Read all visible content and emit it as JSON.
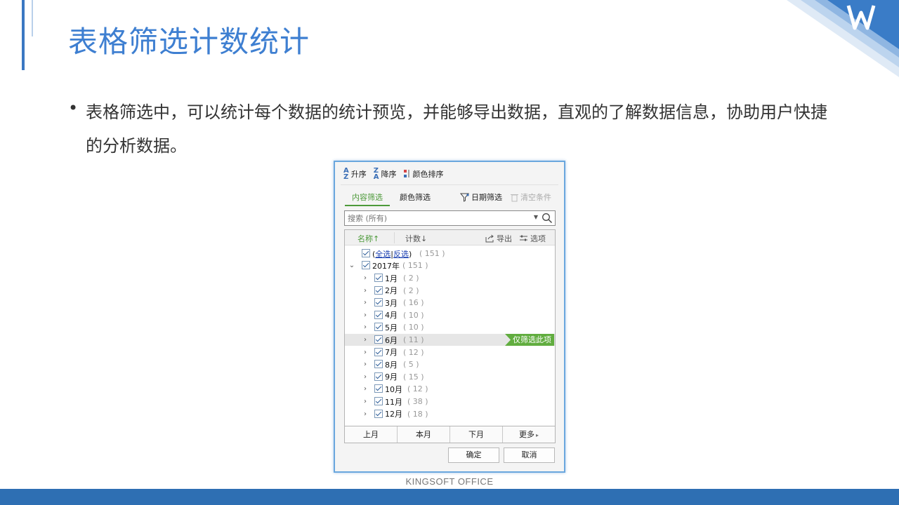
{
  "slide": {
    "title": "表格筛选计数统计",
    "bullet_symbol": "•",
    "body": "表格筛选中，可以统计每个数据的统计预览，并能够导出数据，直观的了解数据信息，协助用户快捷的分析数据。",
    "footer_text": "KINGSOFT   OFFICE",
    "brand_color": "#3e7fd1",
    "footer_color": "#2e6fb3"
  },
  "dialog": {
    "sort": {
      "asc": "升序",
      "desc": "降序",
      "color": "颜色排序"
    },
    "tabs": [
      {
        "label": "内容筛选",
        "active": true
      },
      {
        "label": "颜色筛选",
        "active": false
      }
    ],
    "date_filter": "日期筛选",
    "clear_conditions": "清空条件",
    "search_placeholder": "搜索 (所有)",
    "list_header": {
      "name": "名称",
      "count": "计数",
      "export": "导出",
      "options": "选项"
    },
    "select_all": {
      "all": "全选",
      "separator": "|",
      "invert": "反选",
      "count": "( 151 )"
    },
    "year": {
      "label": "2017年",
      "count": "( 151 )"
    },
    "months": [
      {
        "label": "1月",
        "count": "( 2 )"
      },
      {
        "label": "2月",
        "count": "( 2 )"
      },
      {
        "label": "3月",
        "count": "( 16 )"
      },
      {
        "label": "4月",
        "count": "( 10 )"
      },
      {
        "label": "5月",
        "count": "( 10 )"
      },
      {
        "label": "6月",
        "count": "( 11 )"
      },
      {
        "label": "7月",
        "count": "( 12 )"
      },
      {
        "label": "8月",
        "count": "( 5 )"
      },
      {
        "label": "9月",
        "count": "( 15 )"
      },
      {
        "label": "10月",
        "count": "( 12 )"
      },
      {
        "label": "11月",
        "count": "( 38 )"
      },
      {
        "label": "12月",
        "count": "( 18 )"
      }
    ],
    "only_this": "仅筛选此项",
    "month_buttons": [
      "上月",
      "本月",
      "下月",
      "更多"
    ],
    "more_arrow": "▸",
    "ok": "确定",
    "cancel": "取消",
    "accent_green": "#4d9a3a"
  }
}
